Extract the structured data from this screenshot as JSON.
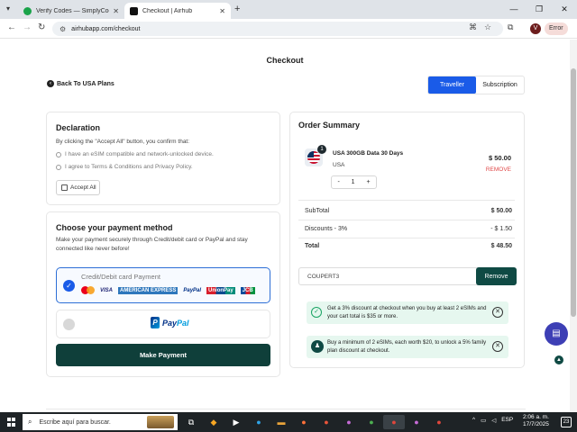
{
  "browser": {
    "tabs": [
      {
        "title": "Verify Codes — SimplyCodes",
        "favicon_color": "#1aa34a"
      },
      {
        "title": "Checkout | Airhub",
        "favicon_color": "#111111"
      }
    ],
    "url": "airhubapp.com/checkout",
    "profile_initial": "V",
    "error_label": "Error"
  },
  "page": {
    "title": "Checkout",
    "back_label": "Back To USA Plans",
    "toggle": {
      "traveller": "Traveller",
      "subscription": "Subscription",
      "active": "traveller"
    }
  },
  "declaration": {
    "heading": "Declaration",
    "intro": "By clicking the \"Accept All\" button, you confirm that:",
    "items": [
      "I have an eSIM compatible and network-unlocked device.",
      "I agree to Terms & Conditions and Privacy Policy."
    ],
    "accept_all": "Accept All"
  },
  "payment": {
    "heading": "Choose your payment method",
    "description": "Make your payment securely through Credit/debit card or PayPal and stay connected like never before!",
    "card_option": "Credit/Debit card Payment",
    "card_logos": [
      "VISA",
      "AMERICAN EXPRESS",
      "PayPal",
      "UnionPay",
      "JCB"
    ],
    "paypal_text_1": "Pay",
    "paypal_text_2": "Pal",
    "button": "Make Payment"
  },
  "order": {
    "heading": "Order Summary",
    "item": {
      "name": "USA 300GB Data 30 Days",
      "region": "USA",
      "price": "$ 50.00",
      "remove": "REMOVE",
      "quantity": "1",
      "badge": "1",
      "minus": "-",
      "plus": "+"
    },
    "subtotal_label": "SubTotal",
    "subtotal_value": "$ 50.00",
    "discount_label": "Discounts - 3%",
    "discount_value": "- $ 1.50",
    "total_label": "Total",
    "total_value": "$ 48.50",
    "coupon_value": "COUPERT3",
    "coupon_remove": "Remove",
    "promos": [
      "Get a 3% discount at checkout when you buy at least 2 eSIMs and your cart total is $35 or more.",
      "Buy a minimum of 2 eSIMs, each worth $20, to unlock a 5% family plan discount at checkout."
    ]
  },
  "taskbar": {
    "search_placeholder": "Escribe aquí para buscar.",
    "lang": "ESP",
    "time": "2:06 a. m.",
    "date": "17/7/2025",
    "notifications": "23"
  },
  "colors": {
    "primary_blue": "#1a5be8",
    "dark_green": "#0f3f3a",
    "remove_red": "#e04a4a",
    "promo_bg": "#e6f7ef"
  }
}
